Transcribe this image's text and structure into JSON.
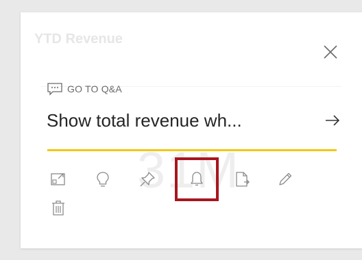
{
  "card": {
    "ghost_title": "YTD Revenue",
    "ghost_value": "31M"
  },
  "qa": {
    "label": "GO TO Q&A",
    "question": "Show total revenue wh..."
  },
  "actions": [
    {
      "name": "focus-mode-icon"
    },
    {
      "name": "lightbulb-icon"
    },
    {
      "name": "pin-icon"
    },
    {
      "name": "bell-icon"
    },
    {
      "name": "export-icon"
    },
    {
      "name": "pencil-icon"
    },
    {
      "name": "trash-icon"
    }
  ],
  "colors": {
    "accent_yellow": "#f2c811",
    "highlight_red": "#a8151e",
    "icon_gray": "#8a8a8a"
  }
}
